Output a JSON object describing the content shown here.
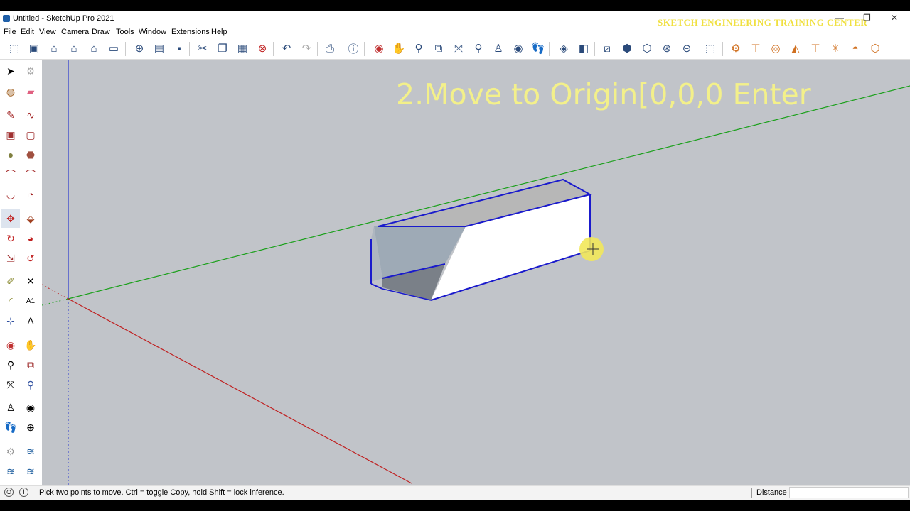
{
  "window": {
    "title": "Untitled - SketchUp Pro 2021",
    "watermark": "SKETCH ENGINEERING TRAINING CENTER"
  },
  "menu": [
    "File",
    "Edit",
    "View",
    "Camera",
    "Draw",
    "Tools",
    "Window",
    "Extensions",
    "Help"
  ],
  "toolbar_icons": [
    "get-models-icon",
    "3d-warehouse-icon",
    "house-icon",
    "warehouse-icon",
    "extension-warehouse-icon",
    "new-file-icon",
    "open-file-icon",
    "save-icon",
    "cut-icon",
    "copy-icon",
    "paste-icon",
    "erase-delete-icon",
    "undo-icon",
    "redo-icon",
    "print-icon",
    "model-info-icon",
    "orbit-icon",
    "pan-icon",
    "zoom-icon",
    "zoom-window-icon",
    "zoom-extents-icon",
    "previous-view-icon",
    "position-camera-icon",
    "look-around-icon",
    "walk-icon",
    "section-plane-icon",
    "display-section-icon",
    "iso-view-icon",
    "top-view-icon",
    "front-view-icon",
    "right-view-icon",
    "back-view-icon",
    "left-view-icon",
    "xray-style-icon",
    "wireframe-style-icon",
    "hidden-line-style-icon",
    "shaded-style-icon",
    "textured-style-icon",
    "monochrome-style-icon"
  ],
  "left_tools": [
    [
      "select-icon",
      "make-component-icon"
    ],
    [
      "paint-bucket-icon",
      "eraser-icon"
    ],
    [
      "line-icon",
      "freehand-icon"
    ],
    [
      "rectangle-icon",
      "rotated-rectangle-icon"
    ],
    [
      "circle-icon",
      "polygon-icon"
    ],
    [
      "arc-icon",
      "two-point-arc-icon"
    ],
    [
      "three-point-arc-icon",
      "pie-icon"
    ],
    [
      "move-icon",
      "push-pull-icon"
    ],
    [
      "rotate-icon",
      "follow-me-icon"
    ],
    [
      "scale-icon",
      "offset-icon"
    ],
    [
      "tape-measure-icon",
      "dimension-icon"
    ],
    [
      "protractor-icon",
      "text-icon"
    ],
    [
      "axes-icon",
      "3d-text-icon"
    ],
    [
      "orbit-icon",
      "pan-icon"
    ],
    [
      "zoom-icon",
      "zoom-window-icon"
    ],
    [
      "zoom-extents-icon",
      "zoom-previous-icon"
    ],
    [
      "position-camera-icon",
      "look-around-icon"
    ],
    [
      "walk-icon",
      "section-plane-icon"
    ],
    [
      "sandbox-from-contours-icon",
      "sandbox-scratch-icon"
    ],
    [
      "smoove-icon",
      "stamp-icon"
    ]
  ],
  "viewport": {
    "overlay_text": "2.Move to Origin[0,0,0 Enter"
  },
  "status": {
    "hint": "Pick two points to move.  Ctrl = toggle Copy, hold Shift = lock inference.",
    "measurement_label": "Distance",
    "measurement_value": ""
  }
}
